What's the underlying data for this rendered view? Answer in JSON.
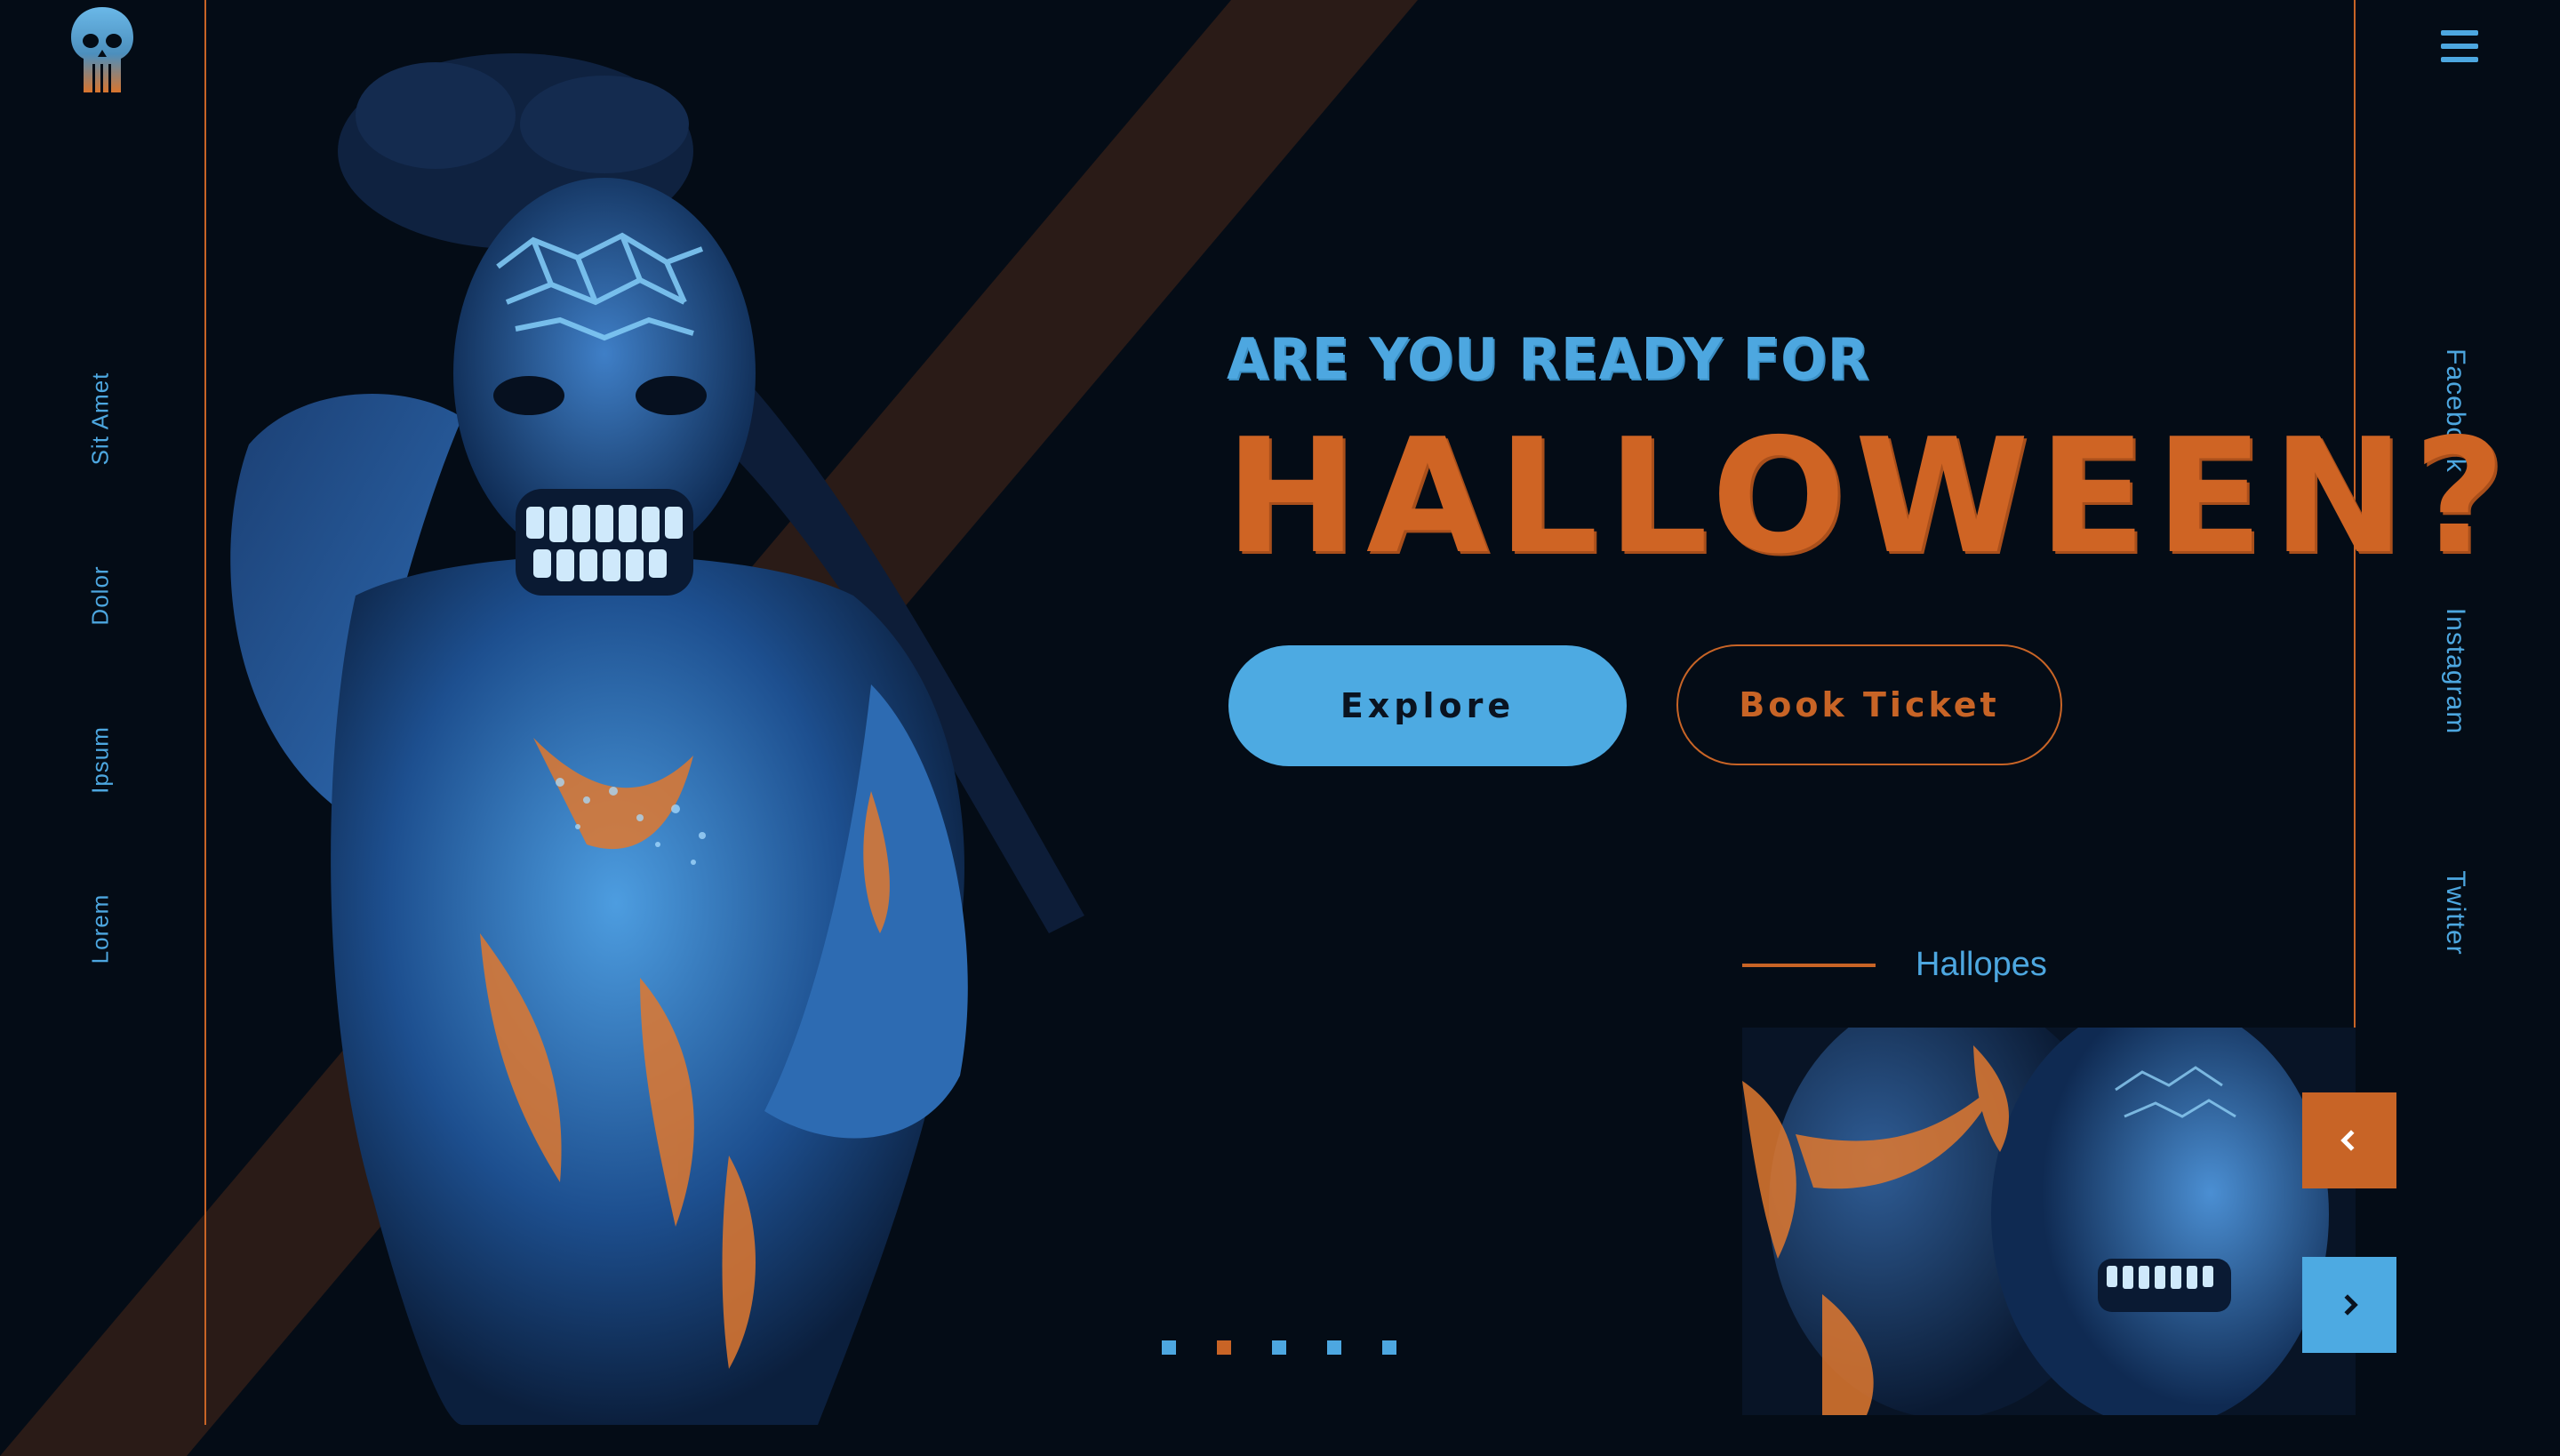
{
  "brand": {
    "logo_icon": "skull-icon"
  },
  "left_nav": {
    "items": [
      {
        "label": "Sit Amet"
      },
      {
        "label": "Dolor"
      },
      {
        "label": "Ipsum"
      },
      {
        "label": "Lorem"
      }
    ]
  },
  "social": {
    "items": [
      {
        "label": "Facebook"
      },
      {
        "label": "Instagram"
      },
      {
        "label": "Twitter"
      }
    ]
  },
  "menu": {
    "icon": "hamburger-menu-icon"
  },
  "hero": {
    "subtitle": "ARE YOU READY FOR",
    "title": "HALLOWEEN?",
    "explore_label": "Explore",
    "ticket_label": "Book Ticket"
  },
  "gallery": {
    "caption": "Hallopes",
    "prev_icon": "chevron-left-icon",
    "next_icon": "chevron-right-icon"
  },
  "slider": {
    "total": 5,
    "active_index": 1
  },
  "colors": {
    "background": "#040c16",
    "accent_orange": "#c86426",
    "accent_blue": "#4da7e0",
    "stripe": "#2b1c18"
  }
}
